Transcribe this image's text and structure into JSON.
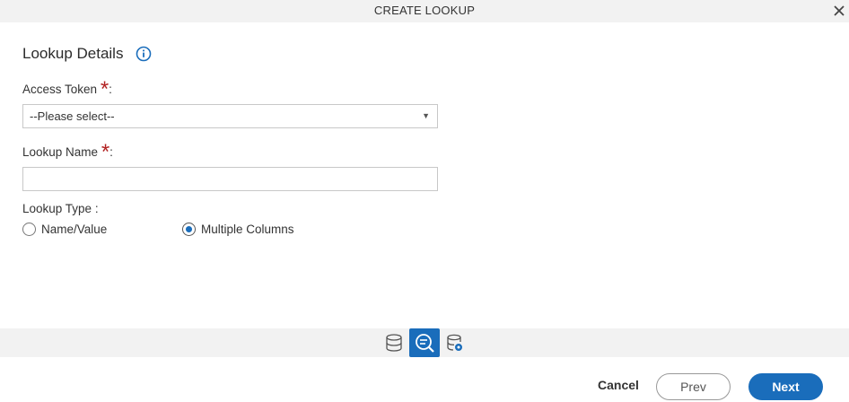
{
  "dialog": {
    "title": "CREATE LOOKUP",
    "close_icon": "close-icon"
  },
  "section": {
    "title": "Lookup Details",
    "info_icon": "info-icon"
  },
  "fields": {
    "access_token": {
      "label": "Access Token",
      "required_mark": "*",
      "colon": ":",
      "selected_value": "--Please select--"
    },
    "lookup_name": {
      "label": "Lookup Name",
      "required_mark": "*",
      "colon": ":",
      "value": "",
      "placeholder": ""
    },
    "lookup_type": {
      "label": "Lookup Type :",
      "options": [
        {
          "label": "Name/Value",
          "checked": false
        },
        {
          "label": "Multiple Columns",
          "checked": true
        }
      ]
    }
  },
  "steps": [
    {
      "icon": "database-icon",
      "active": false
    },
    {
      "icon": "lookup-search-icon",
      "active": true
    },
    {
      "icon": "database-settings-icon",
      "active": false
    }
  ],
  "footer": {
    "cancel_label": "Cancel",
    "prev_label": "Prev",
    "next_label": "Next"
  },
  "colors": {
    "accent": "#1a6dbb",
    "required": "#b22222",
    "bar_background": "#f2f2f2"
  }
}
